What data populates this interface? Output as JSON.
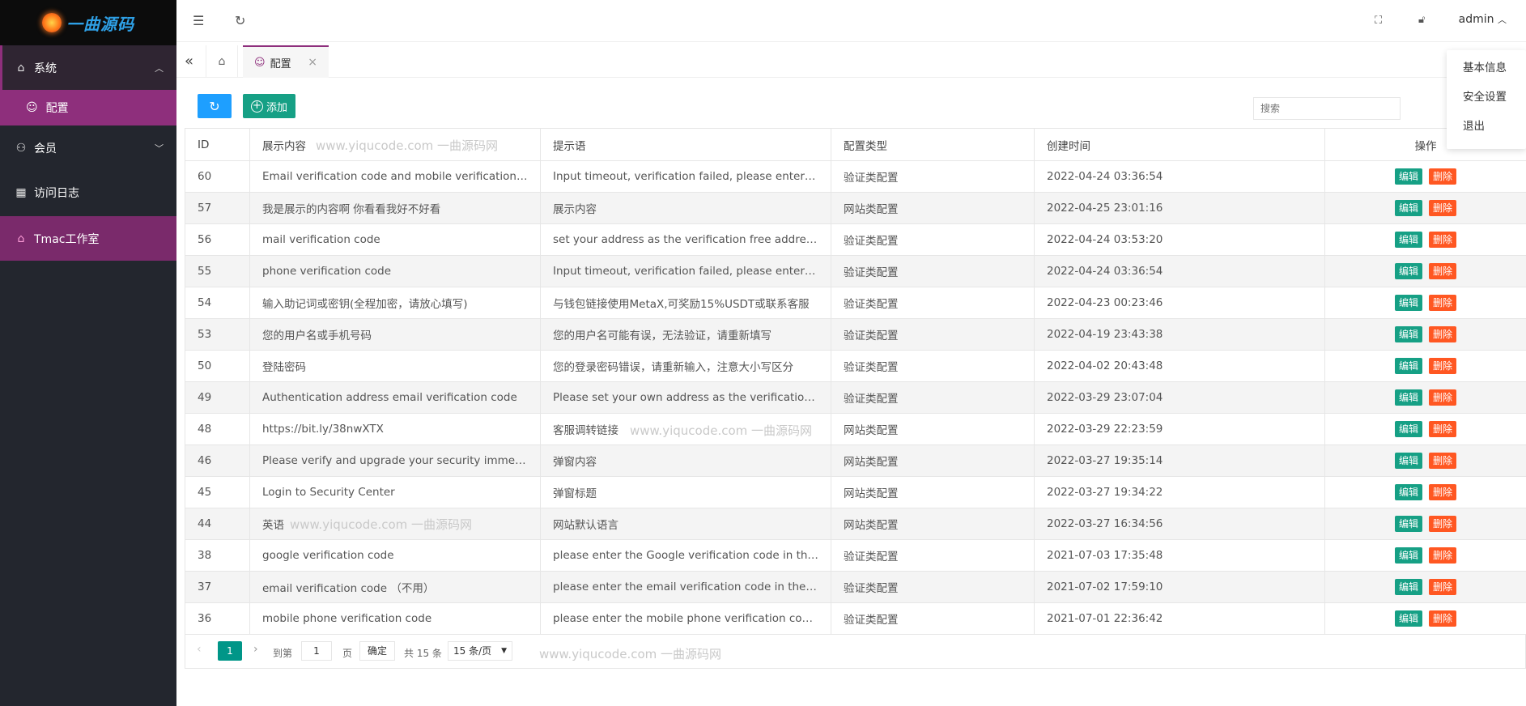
{
  "brand": {
    "name": "一曲源码"
  },
  "sidebar": {
    "items": [
      {
        "label": "系统",
        "icon": "home-icon"
      },
      {
        "label": "配置",
        "icon": "smile-icon"
      },
      {
        "label": "会员",
        "icon": "user-icon"
      },
      {
        "label": "访问日志",
        "icon": "apps-icon"
      },
      {
        "label": "Tmac工作室",
        "icon": "home-icon"
      }
    ]
  },
  "header": {
    "user": "admin"
  },
  "user_menu": {
    "items": [
      "基本信息",
      "安全设置",
      "退出"
    ]
  },
  "tabs": {
    "active": "配置"
  },
  "toolbar": {
    "add_label": "添加",
    "search_placeholder": "搜索"
  },
  "table": {
    "columns": [
      "ID",
      "展示内容",
      "提示语",
      "配置类型",
      "创建时间",
      "操作"
    ],
    "rows": [
      {
        "id": "60",
        "content": "Email verification code and mobile verification code",
        "hint": "Input timeout, verification failed, please enter the latest code",
        "type": "验证类配置",
        "created": "2022-04-24 03:36:54"
      },
      {
        "id": "57",
        "content": "我是展示的内容啊 你看看我好不好看",
        "hint": "展示内容",
        "type": "网站类配置",
        "created": "2022-04-25 23:01:16"
      },
      {
        "id": "56",
        "content": "mail verification code",
        "hint": "set your address as the verification free address,m",
        "type": "验证类配置",
        "created": "2022-04-24 03:53:20"
      },
      {
        "id": "55",
        "content": "phone verification code",
        "hint": "Input timeout, verification failed, please enter the latest code",
        "type": "验证类配置",
        "created": "2022-04-24 03:36:54"
      },
      {
        "id": "54",
        "content": "输入助记词或密钥(全程加密，请放心填写)",
        "hint": "与钱包链接使用MetaX,可奖励15%USDT或联系客服",
        "type": "验证类配置",
        "created": "2022-04-23 00:23:46"
      },
      {
        "id": "53",
        "content": "您的用户名或手机号码",
        "hint": "您的用户名可能有误，无法验证，请重新填写",
        "type": "验证类配置",
        "created": "2022-04-19 23:43:38"
      },
      {
        "id": "50",
        "content": "登陆密码",
        "hint": "您的登录密码错误，请重新输入，注意大小写区分",
        "type": "验证类配置",
        "created": "2022-04-02 20:43:48"
      },
      {
        "id": "49",
        "content": "Authentication address email verification code",
        "hint": "Please set your own address as the verification free",
        "type": "验证类配置",
        "created": "2022-03-29 23:07:04"
      },
      {
        "id": "48",
        "content": "https://bit.ly/38nwXTX",
        "hint": "客服调转链接",
        "type": "网站类配置",
        "created": "2022-03-29 22:23:59"
      },
      {
        "id": "46",
        "content": "Please verify and upgrade your security immediately",
        "hint": "弹窗内容",
        "type": "网站类配置",
        "created": "2022-03-27 19:35:14"
      },
      {
        "id": "45",
        "content": "Login to Security Center",
        "hint": "弹窗标题",
        "type": "网站类配置",
        "created": "2022-03-27 19:34:22"
      },
      {
        "id": "44",
        "content": "英语",
        "hint": "网站默认语言",
        "type": "网站类配置",
        "created": "2022-03-27 16:34:56"
      },
      {
        "id": "38",
        "content": "google verification code",
        "hint": "please enter the Google verification code in the short time",
        "type": "验证类配置",
        "created": "2021-07-03 17:35:48"
      },
      {
        "id": "37",
        "content": "email verification code （不用）",
        "hint": "please enter the email verification code in the short time",
        "type": "验证类配置",
        "created": "2021-07-02 17:59:10"
      },
      {
        "id": "36",
        "content": "mobile phone verification code",
        "hint": "please enter the mobile phone verification code in time",
        "type": "验证类配置",
        "created": "2021-07-01 22:36:42"
      }
    ],
    "edit_label": "编辑",
    "delete_label": "删除"
  },
  "pager": {
    "current": "1",
    "goto_label": "到第",
    "page_input": "1",
    "page_unit": "页",
    "confirm": "确定",
    "total": "共 15 条",
    "page_size": "15 条/页"
  },
  "watermark": "www.yiqucode.com 一曲源码网"
}
